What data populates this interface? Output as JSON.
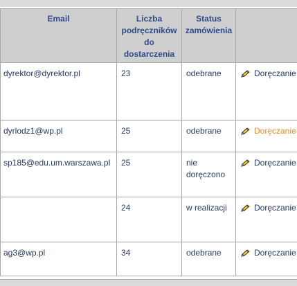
{
  "table": {
    "headers": {
      "email": "Email",
      "count_line1": "Liczba",
      "count_line2": "podręczników",
      "count_line3": "do",
      "count_line4": "dostarczenia",
      "status_line1": "Status",
      "status_line2": "zamówienia",
      "action": ""
    },
    "rows": [
      {
        "email": "dyrektor@dyrektor.pl",
        "count": "23",
        "status_line1": "odebrane",
        "status_line2": "",
        "action": "Doręczanie"
      },
      {
        "email": "dyrlodz1@wp.pl",
        "count": "25",
        "status_line1": "odebrane",
        "status_line2": "",
        "action": "Doręczanie"
      },
      {
        "email": "sp185@edu.um.warszawa.pl",
        "count": "25",
        "status_line1": "nie",
        "status_line2": "doręczono",
        "action": "Doręczanie"
      },
      {
        "email": "",
        "count": "24",
        "status_line1": "w realizacji",
        "status_line2": "",
        "action": "Doręczanie"
      },
      {
        "email": "ag3@wp.pl",
        "count": "34",
        "status_line1": "odebrane",
        "status_line2": "",
        "action": "Doręczanie"
      }
    ]
  },
  "colors": {
    "header_bg": "#cfcfcf",
    "header_text": "#2e4a8c",
    "cell_text": "#2b3a66",
    "link_hover": "#e8912a",
    "border": "#a8a8a8"
  },
  "icons": {
    "action": "pencil-icon"
  }
}
